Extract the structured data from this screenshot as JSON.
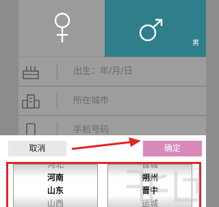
{
  "gender": {
    "male_tag": "男"
  },
  "fields": [
    {
      "icon": "cake-icon",
      "placeholder": "出生：年/月/日"
    },
    {
      "icon": "building-icon",
      "placeholder": "所在城市"
    },
    {
      "icon": "phone-icon",
      "placeholder": "手机号码"
    }
  ],
  "sheet": {
    "cancel_label": "取消",
    "confirm_label": "确定",
    "province_options": [
      "河北",
      "河南",
      "山东",
      "山西"
    ],
    "city_options": [
      "晋城",
      "朔州",
      "晋中",
      "运城"
    ]
  },
  "colors": {
    "male_active": "#2f7e8c",
    "confirm_button": "#d889b9",
    "highlight_annotation": "#e32424"
  }
}
